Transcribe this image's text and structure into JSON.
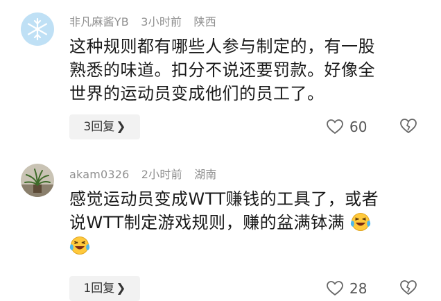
{
  "comments": [
    {
      "username": "非凡麻酱YB",
      "time": "3小时前",
      "location": "陕西",
      "lines": [
        "这种规则都有哪些人参与制定的，有一股",
        "熟悉的味道。扣分不说还要罚款。好像全",
        "世界的运动员变成他们的员工了。"
      ],
      "reply_count_label": "3回复",
      "likes": "60"
    },
    {
      "username": "akam0326",
      "time": "2小时前",
      "location": "湖南",
      "lines": [
        "感觉运动员变成WTT赚钱的工具了，或者",
        "说WTT制定游戏规则，赚的盆满钵满"
      ],
      "reply_count_label": "1回复",
      "likes": "28"
    }
  ],
  "icons": {
    "reply_chevron": "chevron-right-icon",
    "like": "heart-outline-icon",
    "dislike": "broken-heart-icon",
    "emoji": "laughing-crying-emoji"
  },
  "reply_chevron_glyph": "❯"
}
